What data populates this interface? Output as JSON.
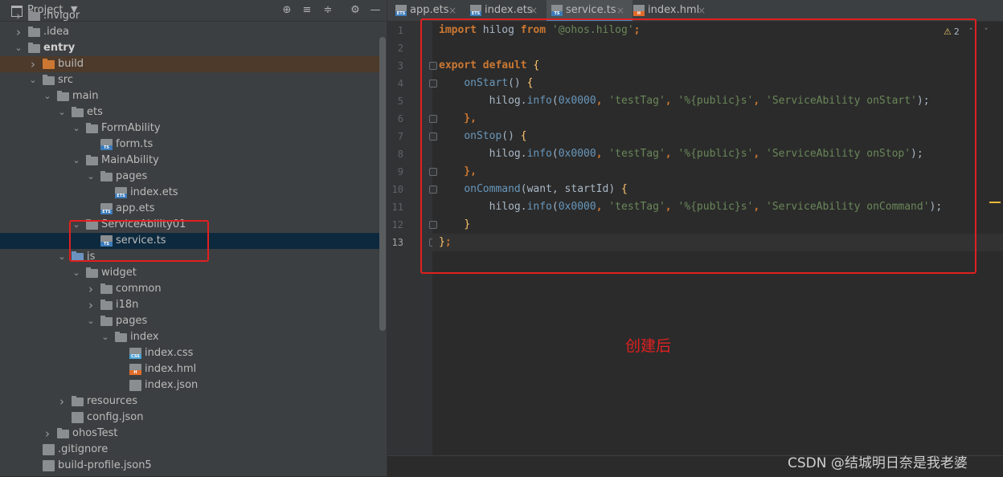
{
  "project_panel": {
    "title": "Project",
    "tree": [
      {
        "label": ".hvigor",
        "kind": "folder"
      },
      {
        "label": ".idea",
        "kind": "folder"
      },
      {
        "label": "entry",
        "kind": "folder"
      },
      {
        "label": "build",
        "kind": "folder"
      },
      {
        "label": "src",
        "kind": "folder"
      },
      {
        "label": "main",
        "kind": "folder"
      },
      {
        "label": "ets",
        "kind": "folder"
      },
      {
        "label": "FormAbility",
        "kind": "folder"
      },
      {
        "label": "form.ts",
        "kind": "file",
        "tag": "TS"
      },
      {
        "label": "MainAbility",
        "kind": "folder"
      },
      {
        "label": "pages",
        "kind": "folder"
      },
      {
        "label": "index.ets",
        "kind": "file",
        "tag": "ETS"
      },
      {
        "label": "app.ets",
        "kind": "file",
        "tag": "ETS"
      },
      {
        "label": "ServiceAbility01",
        "kind": "folder"
      },
      {
        "label": "service.ts",
        "kind": "file",
        "tag": "TS"
      },
      {
        "label": "js",
        "kind": "folder"
      },
      {
        "label": "widget",
        "kind": "folder"
      },
      {
        "label": "common",
        "kind": "folder"
      },
      {
        "label": "i18n",
        "kind": "folder"
      },
      {
        "label": "pages",
        "kind": "folder"
      },
      {
        "label": "index",
        "kind": "folder"
      },
      {
        "label": "index.css",
        "kind": "file",
        "tag": "CSS"
      },
      {
        "label": "index.hml",
        "kind": "file",
        "tag": "H"
      },
      {
        "label": "index.json",
        "kind": "file"
      },
      {
        "label": "resources",
        "kind": "folder"
      },
      {
        "label": "config.json",
        "kind": "file"
      },
      {
        "label": "ohosTest",
        "kind": "folder"
      },
      {
        "label": ".gitignore",
        "kind": "file"
      },
      {
        "label": "build-profile.json5",
        "kind": "file"
      }
    ]
  },
  "tabs": [
    {
      "label": "app.ets",
      "tag": "ETS",
      "active": false
    },
    {
      "label": "index.ets",
      "tag": "ETS",
      "active": false
    },
    {
      "label": "service.ts",
      "tag": "TS",
      "active": true
    },
    {
      "label": "index.hml",
      "tag": "H",
      "active": false
    }
  ],
  "tab_close_glyph": "×",
  "editor": {
    "line_numbers": [
      "1",
      "2",
      "3",
      "4",
      "5",
      "6",
      "7",
      "8",
      "9",
      "10",
      "11",
      "12",
      "13"
    ],
    "lines": [
      [
        {
          "t": "import",
          "c": "kw"
        },
        {
          "t": " hilog ",
          "c": "id"
        },
        {
          "t": "from",
          "c": "kw"
        },
        {
          "t": " ",
          "c": "id"
        },
        {
          "t": "'@ohos.hilog'",
          "c": "str"
        },
        {
          "t": ";",
          "c": "kw"
        }
      ],
      [],
      [
        {
          "t": "export default",
          "c": "kw"
        },
        {
          "t": " {",
          "c": "fn"
        }
      ],
      [
        {
          "t": "    ",
          "c": "id"
        },
        {
          "t": "onStart",
          "c": "meth"
        },
        {
          "t": "() ",
          "c": "id"
        },
        {
          "t": "{",
          "c": "fn"
        }
      ],
      [
        {
          "t": "        hilog.",
          "c": "id"
        },
        {
          "t": "info",
          "c": "meth"
        },
        {
          "t": "(",
          "c": "id"
        },
        {
          "t": "0x0000",
          "c": "num"
        },
        {
          "t": ", ",
          "c": "kw"
        },
        {
          "t": "'testTag'",
          "c": "str"
        },
        {
          "t": ", ",
          "c": "kw"
        },
        {
          "t": "'%{public}s'",
          "c": "str"
        },
        {
          "t": ", ",
          "c": "kw"
        },
        {
          "t": "'ServiceAbility onStart'",
          "c": "str"
        },
        {
          "t": ");",
          "c": "id"
        }
      ],
      [
        {
          "t": "    },",
          "c": "kw"
        }
      ],
      [
        {
          "t": "    ",
          "c": "id"
        },
        {
          "t": "onStop",
          "c": "meth"
        },
        {
          "t": "() ",
          "c": "id"
        },
        {
          "t": "{",
          "c": "fn"
        }
      ],
      [
        {
          "t": "        hilog.",
          "c": "id"
        },
        {
          "t": "info",
          "c": "meth"
        },
        {
          "t": "(",
          "c": "id"
        },
        {
          "t": "0x0000",
          "c": "num"
        },
        {
          "t": ", ",
          "c": "kw"
        },
        {
          "t": "'testTag'",
          "c": "str"
        },
        {
          "t": ", ",
          "c": "kw"
        },
        {
          "t": "'%{public}s'",
          "c": "str"
        },
        {
          "t": ", ",
          "c": "kw"
        },
        {
          "t": "'ServiceAbility onStop'",
          "c": "str"
        },
        {
          "t": ");",
          "c": "id"
        }
      ],
      [
        {
          "t": "    },",
          "c": "kw"
        }
      ],
      [
        {
          "t": "    ",
          "c": "id"
        },
        {
          "t": "onCommand",
          "c": "meth"
        },
        {
          "t": "(want, startId) ",
          "c": "id"
        },
        {
          "t": "{",
          "c": "fn"
        }
      ],
      [
        {
          "t": "        hilog.",
          "c": "id"
        },
        {
          "t": "info",
          "c": "meth"
        },
        {
          "t": "(",
          "c": "id"
        },
        {
          "t": "0x0000",
          "c": "num"
        },
        {
          "t": ", ",
          "c": "kw"
        },
        {
          "t": "'testTag'",
          "c": "str"
        },
        {
          "t": ", ",
          "c": "kw"
        },
        {
          "t": "'%{public}s'",
          "c": "str"
        },
        {
          "t": ", ",
          "c": "kw"
        },
        {
          "t": "'ServiceAbility onCommand'",
          "c": "str"
        },
        {
          "t": ");",
          "c": "id"
        }
      ],
      [
        {
          "t": "    ",
          "c": "id"
        },
        {
          "t": "}",
          "c": "fn"
        }
      ],
      [
        {
          "t": "}",
          "c": "fn"
        },
        {
          "t": ";",
          "c": "kw"
        }
      ]
    ],
    "warning_count": "2",
    "warning_glyph": "⚠"
  },
  "annotation": "创建后",
  "watermark": "CSDN @结城明日奈是我老婆",
  "colors": {
    "highlight_box": "#e02020",
    "selected_row": "#0d293e",
    "accent": "#4a88c7"
  }
}
